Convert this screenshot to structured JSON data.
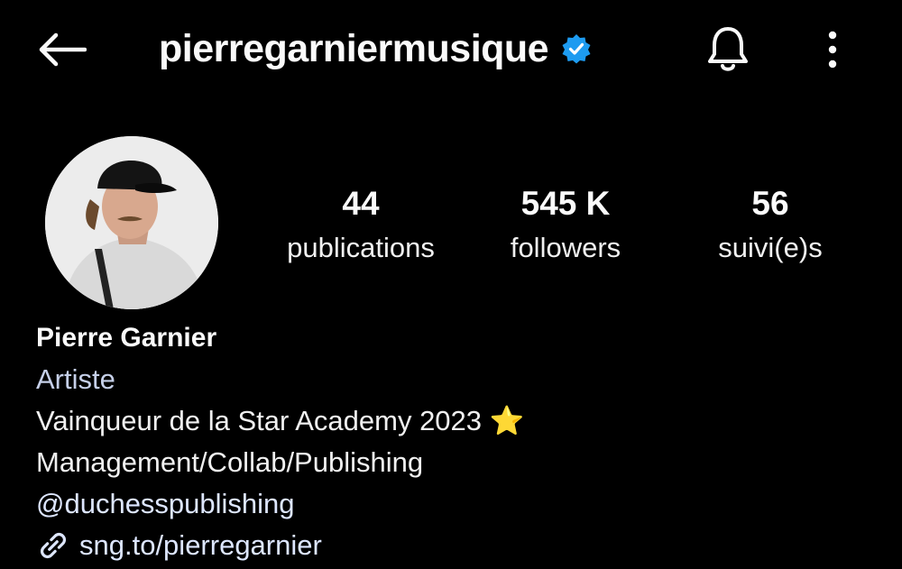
{
  "header": {
    "username": "pierregarniermusique",
    "verified": true,
    "back_icon": "arrow-left-icon",
    "notification_icon": "bell-icon",
    "more_icon": "more-vertical-icon"
  },
  "stats": [
    {
      "value": "44",
      "label": "publications"
    },
    {
      "value": "545 K",
      "label": "followers"
    },
    {
      "value": "56",
      "label": "suivi(e)s"
    }
  ],
  "bio": {
    "name": "Pierre Garnier",
    "category": "Artiste",
    "line1": "Vainqueur de la Star Academy 2023 ⭐",
    "line2": "Management/Collab/Publishing",
    "mention": "@duchesspublishing",
    "link": "sng.to/pierregarnier"
  },
  "colors": {
    "background": "#000000",
    "verified_badge": "#1d9bf0",
    "category_text": "#c5cfe8"
  }
}
